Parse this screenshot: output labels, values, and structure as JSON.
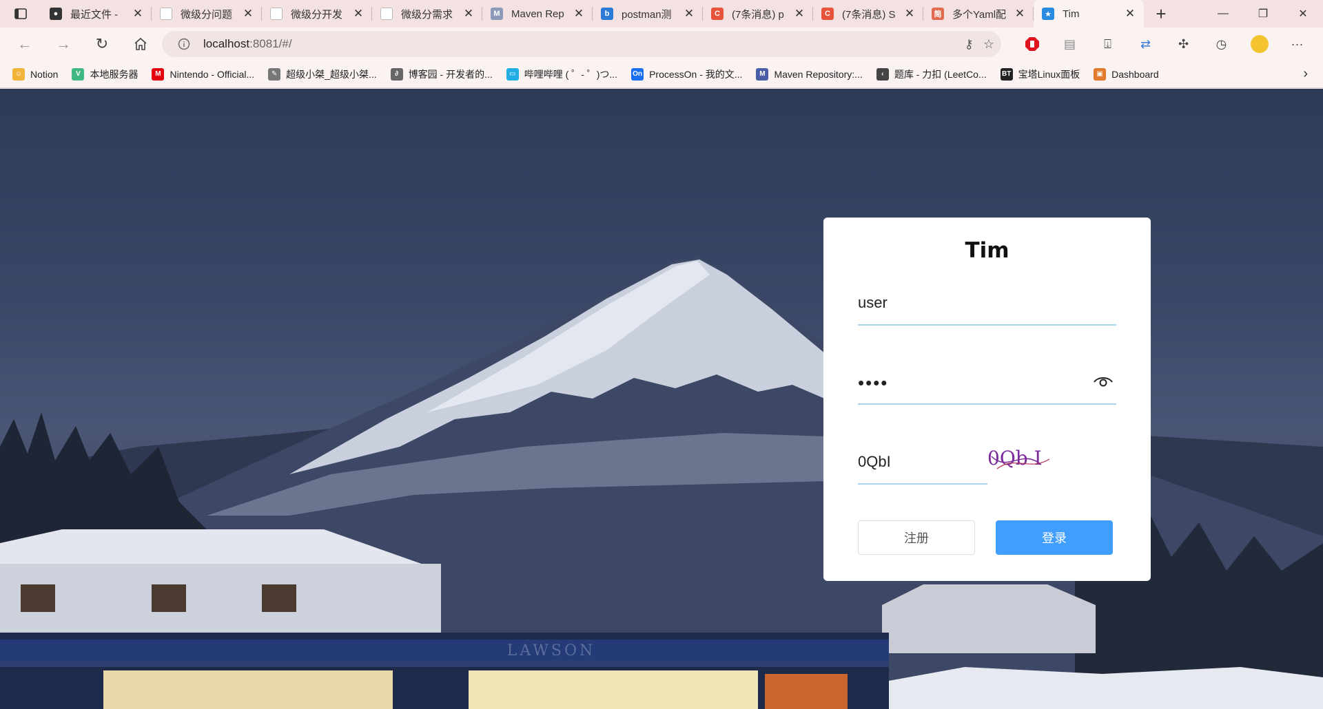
{
  "tabs": [
    {
      "title": "最近文件 -",
      "color": "#333333",
      "glyph": "●"
    },
    {
      "title": "微级分问题",
      "color": "#ffffff",
      "glyph": ""
    },
    {
      "title": "微级分开发",
      "color": "#ffffff",
      "glyph": ""
    },
    {
      "title": "微级分需求",
      "color": "#ffffff",
      "glyph": ""
    },
    {
      "title": "Maven Rep",
      "color": "#8a9ab8",
      "glyph": "M"
    },
    {
      "title": "postman测",
      "color": "#2b7bd6",
      "glyph": "b"
    },
    {
      "title": "(7条消息) p",
      "color": "#e8543a",
      "glyph": "C"
    },
    {
      "title": "(7条消息) S",
      "color": "#e8543a",
      "glyph": "C"
    },
    {
      "title": "多个Yaml配",
      "color": "#e06a4e",
      "glyph": "简"
    },
    {
      "title": "Tim",
      "color": "#2a8ae0",
      "glyph": "★"
    }
  ],
  "address": {
    "host": "localhost",
    "path": ":8081/#/"
  },
  "bookmarks": [
    {
      "label": "Notion",
      "color": "#f2b43a",
      "glyph": "☺"
    },
    {
      "label": "本地服务器",
      "color": "#41b883",
      "glyph": "V"
    },
    {
      "label": "Nintendo - Official...",
      "color": "#e4000f",
      "glyph": "M"
    },
    {
      "label": "超级小桀_超级小桀...",
      "color": "#777777",
      "glyph": "✎"
    },
    {
      "label": "博客园 - 开发者的...",
      "color": "#666666",
      "glyph": "∂"
    },
    {
      "label": "哔哩哔哩 ( ゜- ゜)つ...",
      "color": "#23ade5",
      "glyph": "▭"
    },
    {
      "label": "ProcessOn - 我的文...",
      "color": "#1a6ff0",
      "glyph": "On"
    },
    {
      "label": "Maven Repository:...",
      "color": "#4a5ea8",
      "glyph": "M"
    },
    {
      "label": "题库 - 力扣 (LeetCo...",
      "color": "#444444",
      "glyph": "‹"
    },
    {
      "label": "宝塔Linux面板",
      "color": "#222222",
      "glyph": "BT"
    },
    {
      "label": "Dashboard",
      "color": "#e07a2a",
      "glyph": "▣"
    }
  ],
  "login": {
    "title": "Tim",
    "username": "user",
    "password_mask": "••••",
    "captcha_input": "0QbI",
    "captcha_image_text": "0Qb I",
    "register_label": "注册",
    "login_label": "登录"
  },
  "colors": {
    "accent": "#409eff",
    "input_underline": "#a9d3ee",
    "browser_frame": "#f4e2e2"
  }
}
